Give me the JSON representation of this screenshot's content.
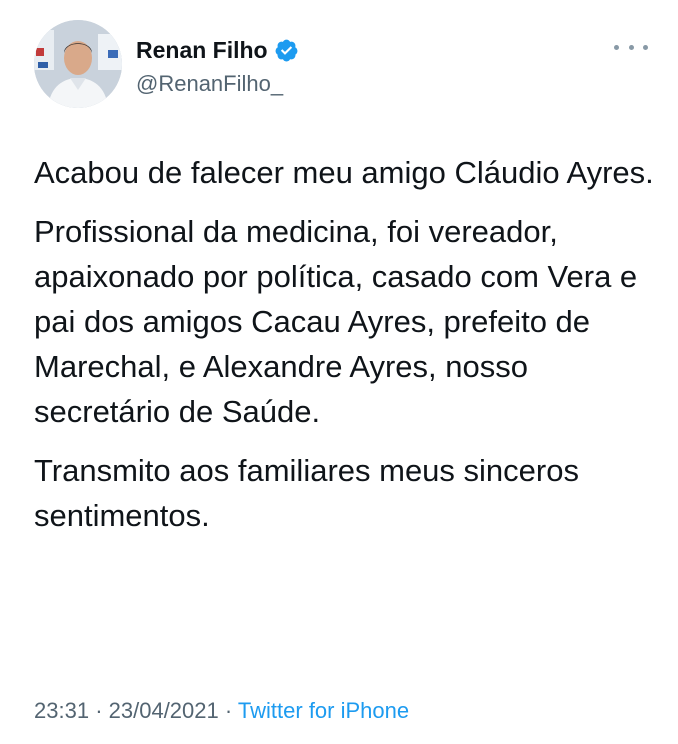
{
  "author": {
    "display_name": "Renan Filho",
    "handle": "@RenanFilho_",
    "verified": true
  },
  "icons": {
    "verified": "verified-badge-icon",
    "more": "more-horizontal-icon"
  },
  "colors": {
    "verified_blue": "#1d9bf0",
    "source_link": "#1d9bf0",
    "secondary_text": "#536471"
  },
  "tweet": {
    "paragraphs": [
      "Acabou de falecer meu amigo Cláudio Ayres.",
      "Profissional da medicina, foi vereador, apaixonado por política, casado com Vera e pai dos amigos Cacau Ayres, prefeito de Marechal, e Alexandre Ayres, nosso secretário de Saúde.",
      "Transmito aos familiares meus sinceros sentimentos."
    ],
    "time": "23:31",
    "separator": "·",
    "date": "23/04/2021",
    "source": "Twitter for iPhone"
  }
}
